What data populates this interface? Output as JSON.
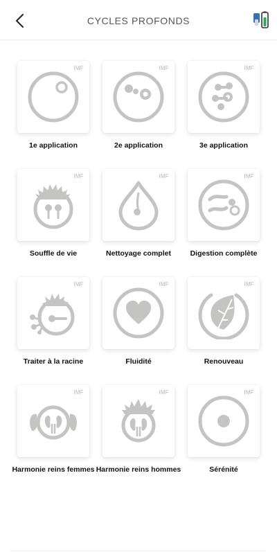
{
  "header": {
    "title": "CYCLES PROFONDS",
    "back_icon": "chevron-left-icon",
    "device_icon": "device-battery-icon"
  },
  "badge": "IMF",
  "colors": {
    "icon": "#c4c4c2",
    "text": "#111111",
    "title": "#555555"
  },
  "programs": [
    {
      "label": "1e application",
      "icon": "circle-dot-icon"
    },
    {
      "label": "2e application",
      "icon": "circle-molecules-icon"
    },
    {
      "label": "3e application",
      "icon": "circle-chain-icon"
    },
    {
      "label": "Souffle de vie",
      "icon": "lungs-sun-icon"
    },
    {
      "label": "Nettoyage complet",
      "icon": "drop-icon"
    },
    {
      "label": "Digestion complète",
      "icon": "digestion-icon"
    },
    {
      "label": "Traiter à la racine",
      "icon": "root-sun-icon"
    },
    {
      "label": "Fluidité",
      "icon": "heart-icon"
    },
    {
      "label": "Renouveau",
      "icon": "leaf-icon"
    },
    {
      "label": "Harmonie reins femmes",
      "icon": "kidneys-women-icon"
    },
    {
      "label": "Harmonie reins hommes",
      "icon": "kidneys-men-icon"
    },
    {
      "label": "Sérénité",
      "icon": "serenity-icon"
    }
  ]
}
